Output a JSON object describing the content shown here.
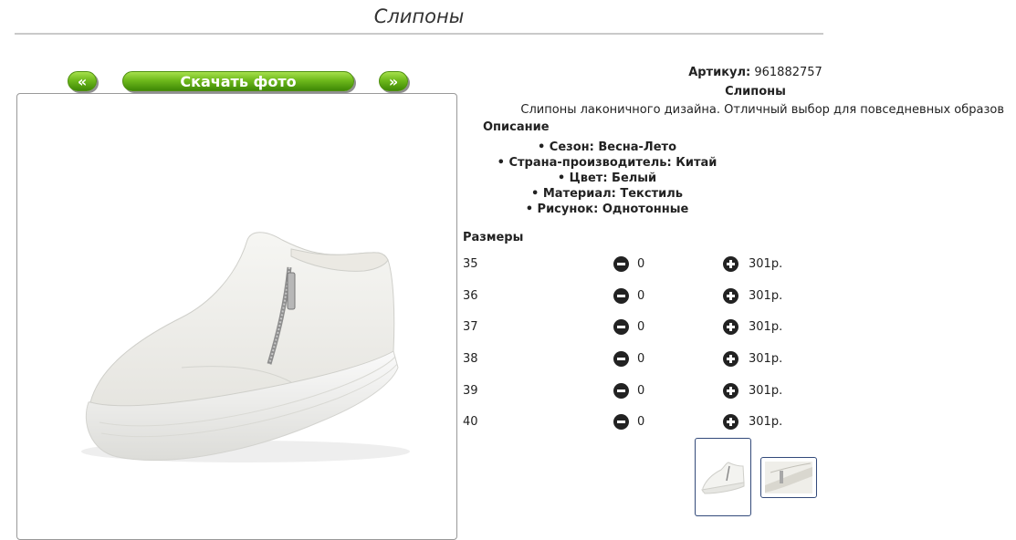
{
  "page": {
    "title": "Слипоны"
  },
  "gallery": {
    "prev_label": "«",
    "download_label": "Скачать фото",
    "next_label": "»"
  },
  "product": {
    "sku_label": "Артикул:",
    "sku_value": "961882757",
    "name": "Слипоны",
    "description": "Слипоны лаконичного дизайна. Отличный выбор для повседневных образов",
    "description_heading": "Описание",
    "properties": [
      "• Сезон: Весна-Лето",
      "• Страна-производитель: Китай",
      "• Цвет: Белый",
      "• Материал: Текстиль",
      "• Рисунок: Однотонные"
    ]
  },
  "sizes": {
    "heading": "Размеры",
    "rows": [
      {
        "size": "35",
        "qty": "0",
        "price": "301р."
      },
      {
        "size": "36",
        "qty": "0",
        "price": "301р."
      },
      {
        "size": "37",
        "qty": "0",
        "price": "301р."
      },
      {
        "size": "38",
        "qty": "0",
        "price": "301р."
      },
      {
        "size": "39",
        "qty": "0",
        "price": "301р."
      },
      {
        "size": "40",
        "qty": "0",
        "price": "301р."
      }
    ]
  },
  "colors": {
    "button_green": "#6fba1c",
    "thumb_border": "#334a7a"
  }
}
